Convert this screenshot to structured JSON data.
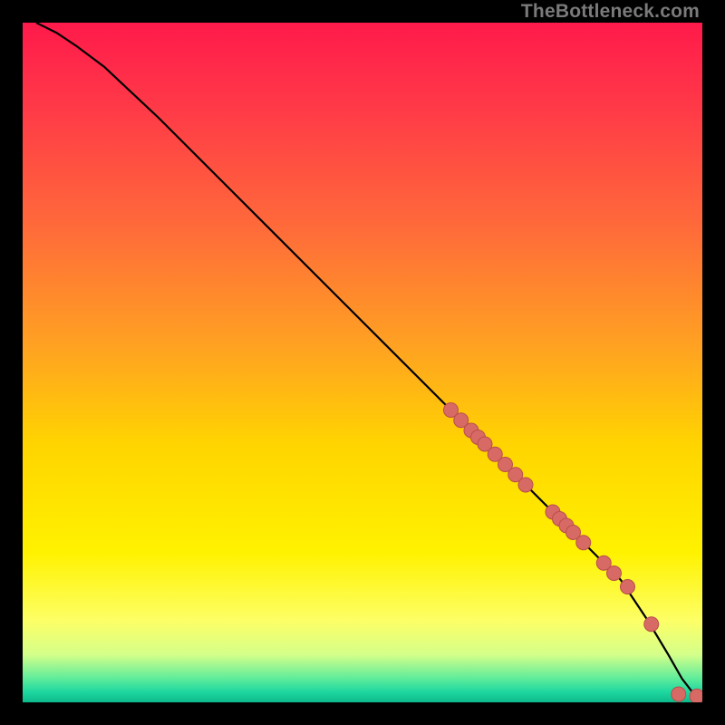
{
  "watermark": "TheBottleneck.com",
  "colors": {
    "gradient_stops": [
      {
        "offset": 0.0,
        "color": "#ff1a4b"
      },
      {
        "offset": 0.12,
        "color": "#ff3848"
      },
      {
        "offset": 0.3,
        "color": "#ff6a3a"
      },
      {
        "offset": 0.48,
        "color": "#ffa321"
      },
      {
        "offset": 0.62,
        "color": "#ffd400"
      },
      {
        "offset": 0.78,
        "color": "#fff200"
      },
      {
        "offset": 0.88,
        "color": "#fdff66"
      },
      {
        "offset": 0.93,
        "color": "#d4ff8a"
      },
      {
        "offset": 0.965,
        "color": "#5eec9a"
      },
      {
        "offset": 0.985,
        "color": "#1dd7a0"
      },
      {
        "offset": 1.0,
        "color": "#0db98a"
      }
    ],
    "curve": "#000000",
    "marker_fill": "#d86a66",
    "marker_stroke": "#b94e4a"
  },
  "chart_data": {
    "type": "line",
    "title": "",
    "xlabel": "",
    "ylabel": "",
    "xlim": [
      0,
      100
    ],
    "ylim": [
      0,
      100
    ],
    "series": [
      {
        "name": "curve",
        "x": [
          2,
          5,
          8,
          12,
          20,
          30,
          40,
          50,
          60,
          70,
          80,
          88,
          92,
          95,
          97,
          99,
          100
        ],
        "y": [
          100,
          98.5,
          96.5,
          93.5,
          86,
          76,
          66,
          56,
          46,
          36,
          26,
          18,
          12,
          7,
          3.5,
          0.9,
          0.7
        ]
      }
    ],
    "markers": {
      "name": "highlighted-points",
      "x": [
        63,
        64.5,
        66,
        67,
        68,
        69.5,
        71,
        72.5,
        74,
        78,
        79,
        80,
        81,
        82.5,
        85.5,
        87,
        89,
        92.5,
        96.5,
        99.2
      ],
      "y": [
        43,
        41.5,
        40,
        39,
        38,
        36.5,
        35,
        33.5,
        32,
        28,
        27,
        26,
        25,
        23.5,
        20.5,
        19,
        17,
        11.5,
        1.2,
        0.9
      ]
    }
  }
}
